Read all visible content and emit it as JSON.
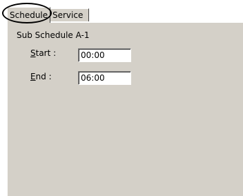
{
  "tabs": [
    {
      "label": "Schedule",
      "selected": true
    },
    {
      "label": "Service",
      "selected": false
    }
  ],
  "panel": {
    "section_title": "Sub Schedule A-1",
    "fields": {
      "start": {
        "label_accel": "S",
        "label_rest": "tart :",
        "value": "00:00"
      },
      "end": {
        "label_accel": "E",
        "label_rest": "nd :",
        "value": "06:00"
      }
    }
  },
  "colors": {
    "dialog_face": "#d4d0c8",
    "field_background": "#ffffff",
    "highlight_ellipse": "#000000"
  }
}
